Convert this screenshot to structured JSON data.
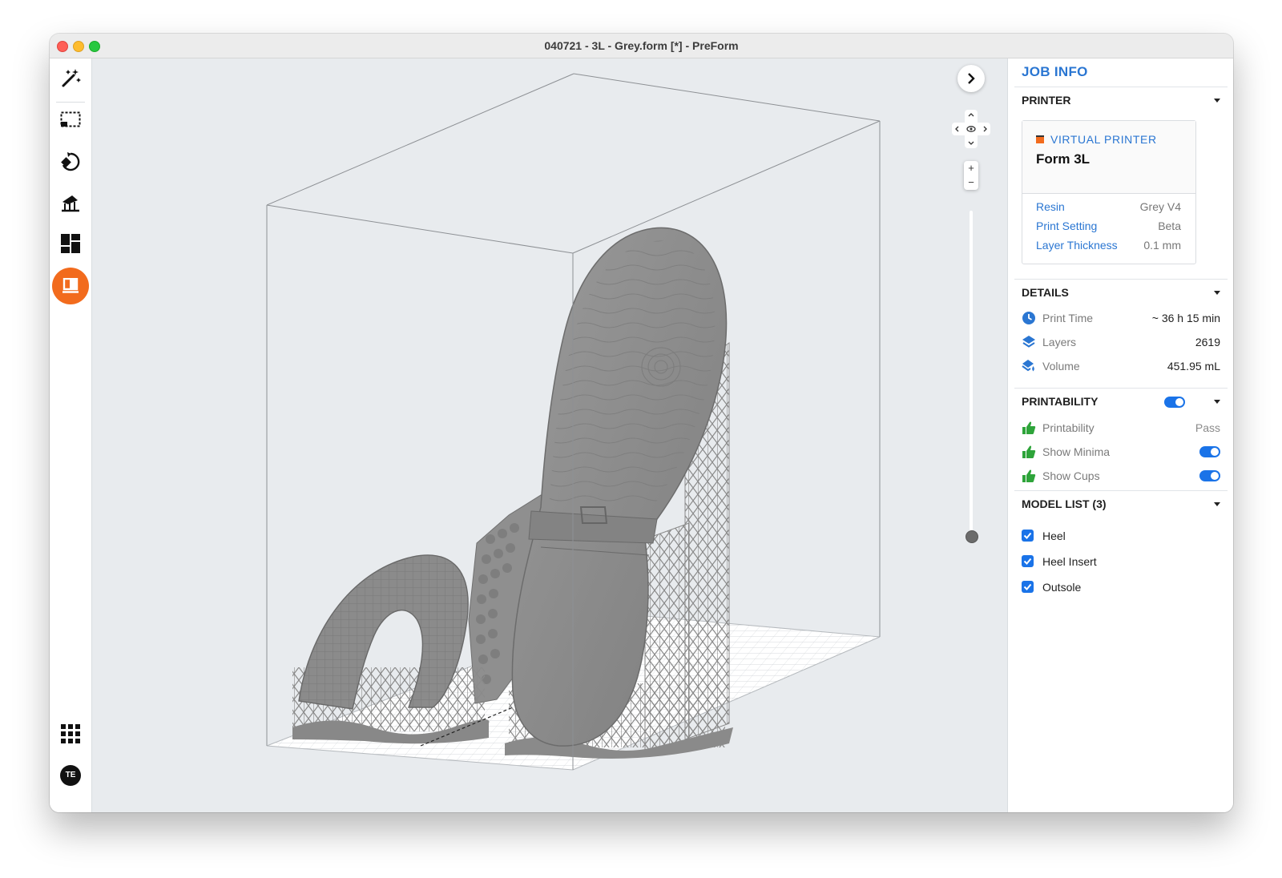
{
  "window": {
    "title": "040721 - 3L - Grey.form [*] - PreForm"
  },
  "toolbar": {
    "tools": [
      "magic-wand-icon",
      "select-icon",
      "orient-icon",
      "supports-icon",
      "layout-icon",
      "job-info-icon"
    ],
    "active_tool": "job-info-icon",
    "bottom": [
      "apps-grid-icon",
      "user-avatar"
    ],
    "avatar_initials": "TE",
    "active_color": "#f26b1d"
  },
  "viewport": {
    "zoom_in": "+",
    "zoom_out": "−"
  },
  "panel": {
    "title": "JOB INFO",
    "printer": {
      "section": "PRINTER",
      "virtual_label": "VIRTUAL PRINTER",
      "name": "Form 3L",
      "props": [
        {
          "key": "Resin",
          "value": "Grey V4"
        },
        {
          "key": "Print Setting",
          "value": "Beta"
        },
        {
          "key": "Layer Thickness",
          "value": "0.1 mm"
        }
      ]
    },
    "details": {
      "section": "DETAILS",
      "rows": [
        {
          "label": "Print Time",
          "value": "~ 36 h 15 min",
          "icon": "clock-icon"
        },
        {
          "label": "Layers",
          "value": "2619",
          "icon": "layers-icon"
        },
        {
          "label": "Volume",
          "value": "451.95 mL",
          "icon": "volume-icon"
        }
      ]
    },
    "printability": {
      "section": "PRINTABILITY",
      "enabled": true,
      "rows": [
        {
          "label": "Printability",
          "value": "Pass",
          "icon": "thumbs-up-icon"
        },
        {
          "label": "Show Minima",
          "toggle": true,
          "icon": "thumbs-up-icon"
        },
        {
          "label": "Show Cups",
          "toggle": true,
          "icon": "thumbs-up-icon"
        }
      ]
    },
    "models": {
      "section": "MODEL LIST (3)",
      "items": [
        {
          "label": "Heel",
          "checked": true
        },
        {
          "label": "Heel Insert",
          "checked": true
        },
        {
          "label": "Outsole",
          "checked": true
        }
      ]
    }
  },
  "colors": {
    "accent_blue": "#2a76d2",
    "toggle_blue": "#1a73e8",
    "pass_green": "#2ea43a",
    "model_grey": "#8e8e8e"
  }
}
